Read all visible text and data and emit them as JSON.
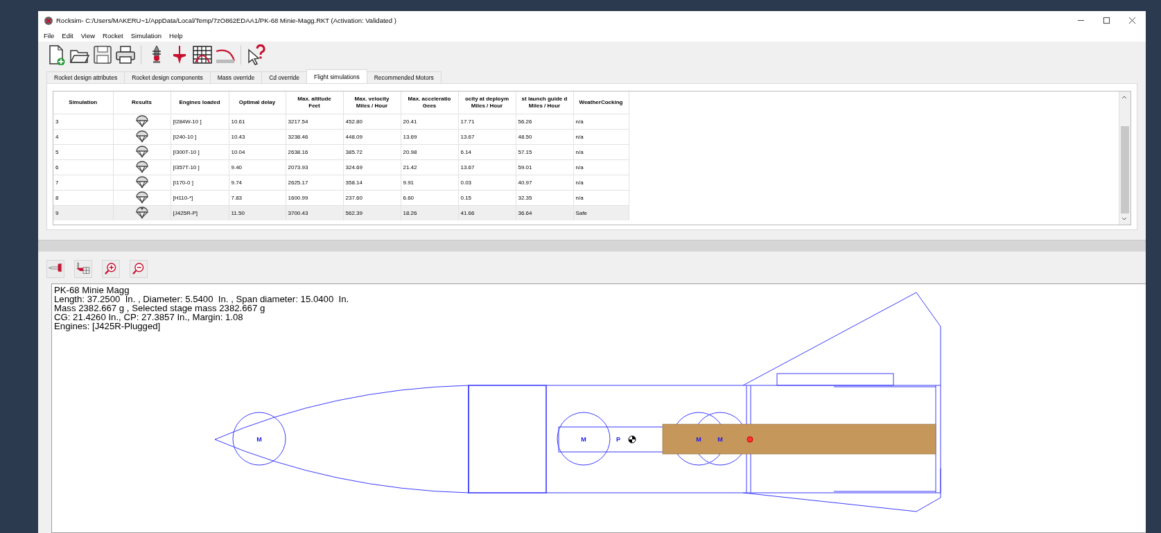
{
  "window": {
    "title": "Rocksim- C:/Users/MAKERU~1/AppData/Local/Temp/7zO862EDAA1/PK-68 Minie-Magg.RKT  (Activation: Validated )"
  },
  "menu": [
    "File",
    "Edit",
    "View",
    "Rocket",
    "Simulation",
    "Help"
  ],
  "tabs": [
    {
      "label": "Rocket design attributes",
      "selected": false
    },
    {
      "label": "Rocket design components",
      "selected": false
    },
    {
      "label": "Mass override",
      "selected": false
    },
    {
      "label": "Cd override",
      "selected": false
    },
    {
      "label": "Flight simulations",
      "selected": true
    },
    {
      "label": "Recommended Motors",
      "selected": false
    }
  ],
  "table": {
    "columns": [
      [
        "Simulation"
      ],
      [
        "Results"
      ],
      [
        "Engines loaded"
      ],
      [
        "Optimal delay"
      ],
      [
        "Max. altitude",
        "Feet"
      ],
      [
        "Max. velocity",
        "Miles / Hour"
      ],
      [
        "Max. acceleratio",
        "Gees"
      ],
      [
        "ocity at deploym",
        "Miles / Hour"
      ],
      [
        "st launch guide d",
        "Miles / Hour"
      ],
      [
        "WeatherCocking"
      ]
    ],
    "rows": [
      {
        "simulation": "3",
        "engines": "[I284W-10 ]",
        "delay": "10.61",
        "altitude": "3217.54",
        "velocity": "452.80",
        "acceleration": "20.41",
        "deploy_velocity": "17.71",
        "guide_velocity": "56.26",
        "weathercocking": "n/a",
        "selected": false
      },
      {
        "simulation": "4",
        "engines": "[I240-10 ]",
        "delay": "10.43",
        "altitude": "3238.46",
        "velocity": "448.09",
        "acceleration": "13.69",
        "deploy_velocity": "13.67",
        "guide_velocity": "48.50",
        "weathercocking": "n/a",
        "selected": false
      },
      {
        "simulation": "5",
        "engines": "[I300T-10 ]",
        "delay": "10.04",
        "altitude": "2638.16",
        "velocity": "385.72",
        "acceleration": "20.98",
        "deploy_velocity": "6.14",
        "guide_velocity": "57.15",
        "weathercocking": "n/a",
        "selected": false
      },
      {
        "simulation": "6",
        "engines": "[I357T-10 ]",
        "delay": "9.40",
        "altitude": "2073.93",
        "velocity": "324.69",
        "acceleration": "21.42",
        "deploy_velocity": "13.67",
        "guide_velocity": "59.01",
        "weathercocking": "n/a",
        "selected": false
      },
      {
        "simulation": "7",
        "engines": "[I170-0 ]",
        "delay": "9.74",
        "altitude": "2625.17",
        "velocity": "358.14",
        "acceleration": "9.91",
        "deploy_velocity": "0.03",
        "guide_velocity": "40.97",
        "weathercocking": "n/a",
        "selected": false
      },
      {
        "simulation": "8",
        "engines": "[H110-*]",
        "delay": "7.83",
        "altitude": "1600.99",
        "velocity": "237.60",
        "acceleration": "6.60",
        "deploy_velocity": "0.15",
        "guide_velocity": "32.35",
        "weathercocking": "n/a",
        "selected": false
      },
      {
        "simulation": "9",
        "engines": "[J425R-P]",
        "delay": "11.50",
        "altitude": "3700.43",
        "velocity": "562.39",
        "acceleration": "18.26",
        "deploy_velocity": "41.66",
        "guide_velocity": "36.64",
        "weathercocking": "Safe",
        "selected": true
      }
    ]
  },
  "design": {
    "info": [
      "PK-68 Minie Magg",
      "Length: 37.2500  In. , Diameter: 5.5400  In. , Span diameter: 15.0400  In.",
      "Mass 2382.667 g , Selected stage mass 2382.667 g",
      "CG: 21.4260 In., CP: 27.3857 In., Margin: 1.08",
      "Engines: [J425R-Plugged]"
    ],
    "labels": [
      "M",
      "M",
      "P",
      "M",
      "M"
    ]
  }
}
